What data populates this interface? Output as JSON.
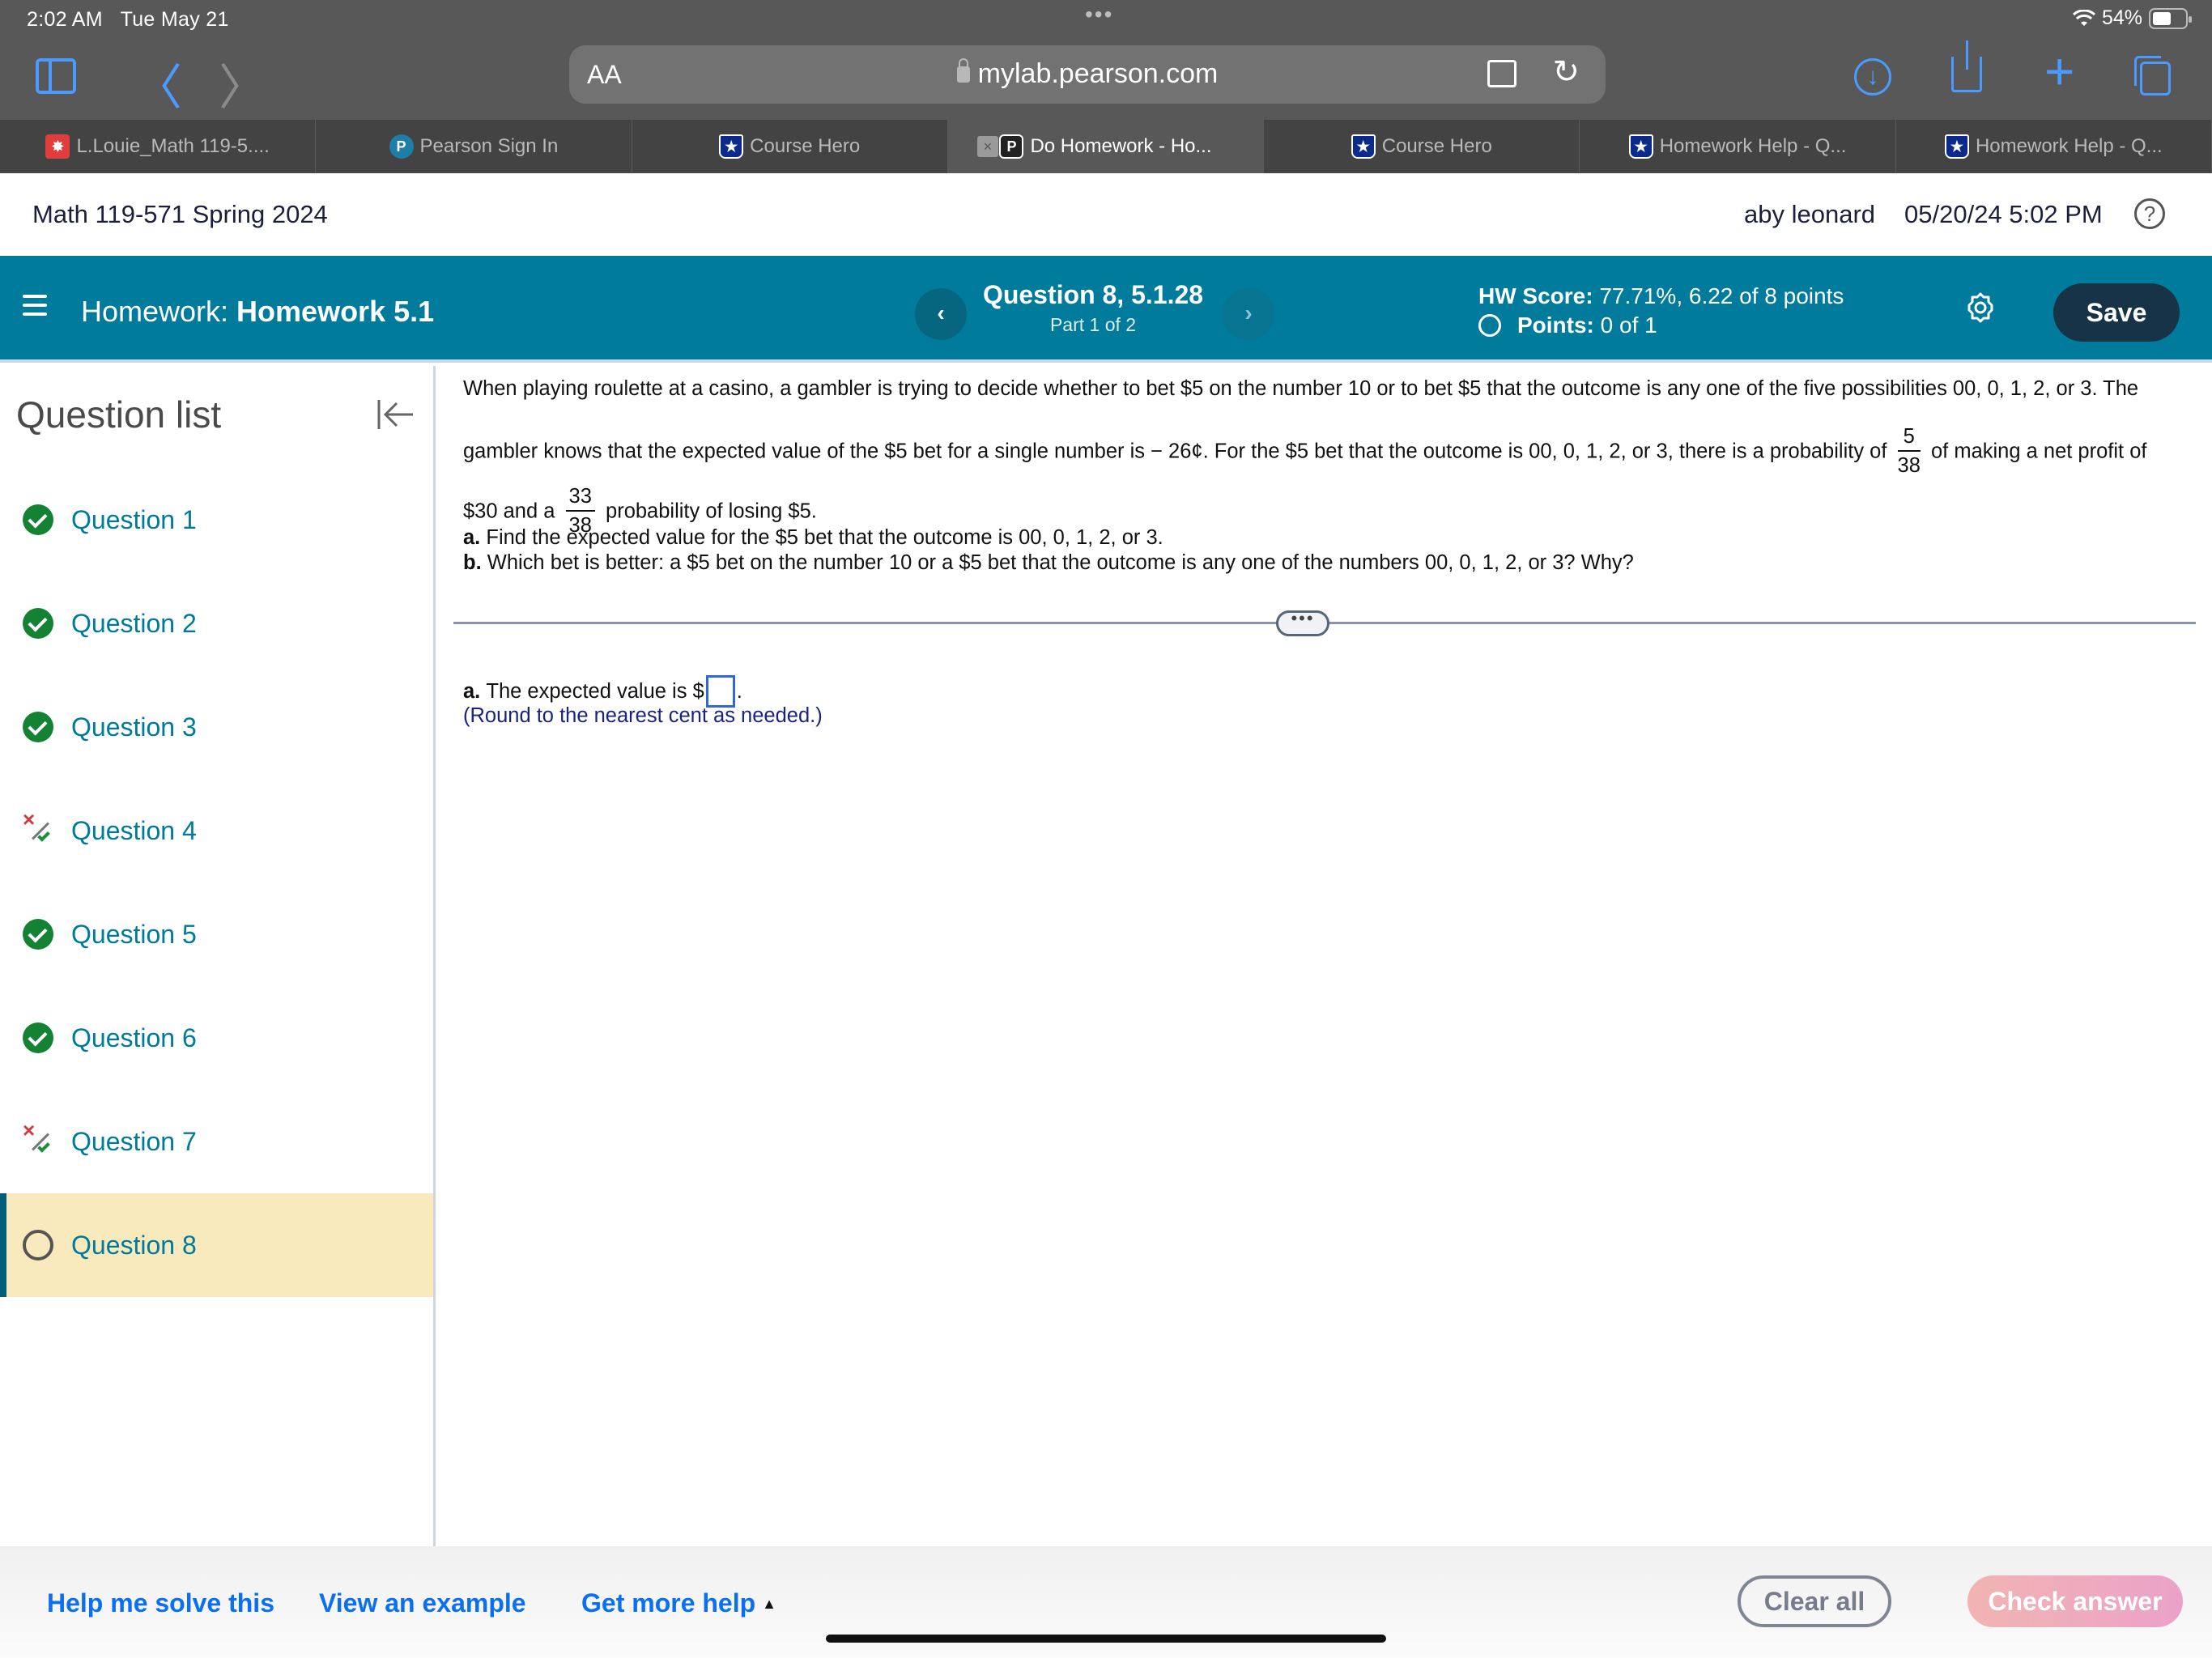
{
  "status_bar": {
    "time": "2:02 AM",
    "date": "Tue May 21",
    "battery": "54%",
    "wifi_icon": "wifi-icon"
  },
  "browser": {
    "text_size_label": "AA",
    "url": "mylab.pearson.com",
    "tabs": [
      {
        "title": "L.Louie_Math 119-5....",
        "favicon": "canvas-icon",
        "active": false
      },
      {
        "title": "Pearson Sign In",
        "favicon": "pearson-icon",
        "active": false
      },
      {
        "title": "Course Hero",
        "favicon": "coursehero-icon",
        "active": false
      },
      {
        "title": "Do Homework - Ho...",
        "favicon": "pearson-p-icon",
        "active": true
      },
      {
        "title": "Course Hero",
        "favicon": "coursehero-icon",
        "active": false
      },
      {
        "title": "Homework Help - Q...",
        "favicon": "coursehero-icon",
        "active": false
      },
      {
        "title": "Homework Help - Q...",
        "favicon": "coursehero-icon",
        "active": false
      }
    ],
    "tab_close_glyph": "×",
    "favicon_letters": {
      "pearson": "P",
      "pearson_dark": "P",
      "coursehero": "★"
    }
  },
  "course_bar": {
    "course": "Math 119-571 Spring 2024",
    "user": "aby leonard",
    "datetime": "05/20/24 5:02 PM",
    "help_glyph": "?"
  },
  "header": {
    "homework_prefix": "Homework:",
    "homework_name": "Homework 5.1",
    "question_title": "Question 8, 5.1.28",
    "part": "Part 1 of 2",
    "prev_glyph": "‹",
    "next_glyph": "›",
    "hw_score_label": "HW Score:",
    "hw_score_value": "77.71%, 6.22 of 8 points",
    "points_label": "Points:",
    "points_value": "0 of 1",
    "save_label": "Save"
  },
  "sidebar": {
    "title": "Question list",
    "questions": [
      {
        "label": "Question 1",
        "status": "correct"
      },
      {
        "label": "Question 2",
        "status": "correct"
      },
      {
        "label": "Question 3",
        "status": "correct"
      },
      {
        "label": "Question 4",
        "status": "partial"
      },
      {
        "label": "Question 5",
        "status": "correct"
      },
      {
        "label": "Question 6",
        "status": "correct"
      },
      {
        "label": "Question 7",
        "status": "partial"
      },
      {
        "label": "Question 8",
        "status": "current"
      }
    ]
  },
  "question": {
    "line1": "When playing roulette at a casino, a gambler is trying to decide whether to bet $5 on the number 10 or to bet $5 that the outcome is any one of the five possibilities 00, 0, 1, 2, or 3. The",
    "line2_before": "gambler knows that the expected value of the $5 bet for a single number is − 26¢. For the $5 bet that the outcome is 00, 0, 1, 2, or 3, there is a probability of",
    "frac1_num": "5",
    "frac1_den": "38",
    "line2_after": "of making a net profit of",
    "line3_before": "$30 and a",
    "frac2_num": "33",
    "frac2_den": "38",
    "line3_after": "probability of losing $5.",
    "part_a_label": "a.",
    "part_a_text": "Find the expected value for the $5 bet that the outcome is 00, 0, 1, 2, or 3.",
    "part_b_label": "b.",
    "part_b_text": "Which bet is better: a $5 bet on the number 10 or a $5 bet that the outcome is any one of the numbers 00, 0, 1, 2, or 3? Why?",
    "divider_handle": "•••"
  },
  "answer": {
    "label": "a.",
    "text_before": "The expected value is $",
    "value": "",
    "text_after": ".",
    "hint": "(Round to the nearest cent as needed.)"
  },
  "footer": {
    "help_me_solve": "Help me solve this",
    "view_example": "View an example",
    "get_more_help": "Get more help",
    "more_help_arrow": "▲",
    "clear_all": "Clear all",
    "check_answer": "Check answer"
  },
  "colors": {
    "header_teal": "#007b9c",
    "save_button": "#173347",
    "correct_green": "#138233",
    "current_highlight": "#f8eabd",
    "link_blue": "#0a6ff0",
    "question_link": "#007a9a"
  }
}
